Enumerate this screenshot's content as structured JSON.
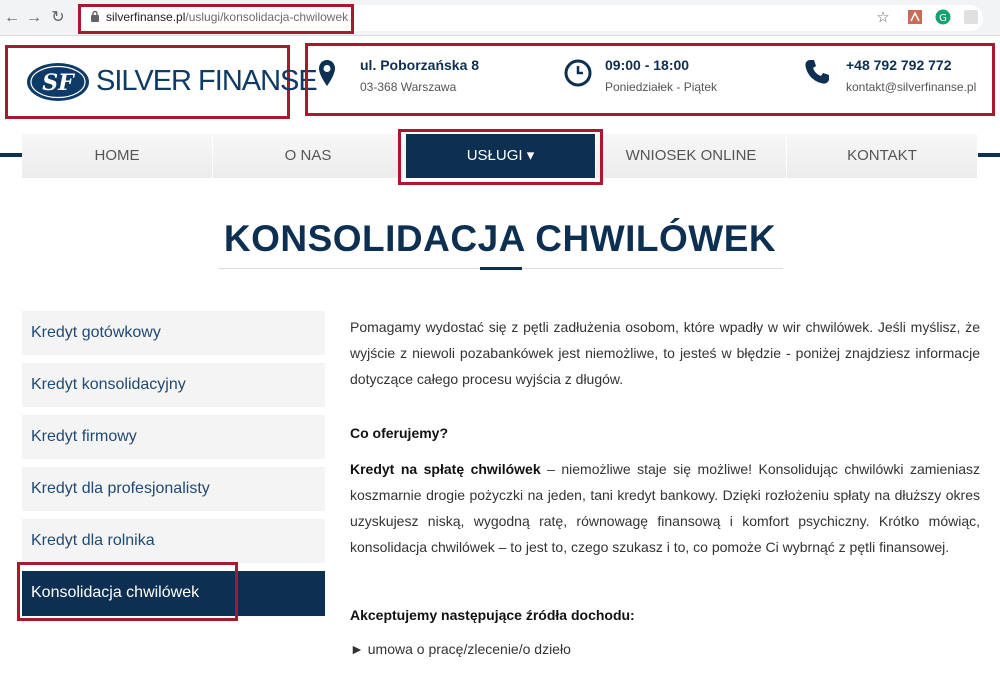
{
  "browser": {
    "url_domain": "silverfinanse.pl",
    "url_path": "/uslugi/konsolidacja-chwilowek",
    "back_icon": "arrow-left-icon",
    "forward_icon": "arrow-right-icon",
    "reload_icon": "reload-icon"
  },
  "logo": {
    "initials": "SF",
    "name": "SILVER FINANSE"
  },
  "contact": {
    "address": {
      "title": "ul. Poborzańska 8",
      "sub": "03-368 Warszawa"
    },
    "hours": {
      "title": "09:00 - 18:00",
      "sub": "Poniedziałek - Piątek"
    },
    "phone": {
      "title": "+48 792 792 772",
      "sub": "kontakt@silverfinanse.pl"
    }
  },
  "nav": {
    "items": [
      {
        "label": "HOME"
      },
      {
        "label": "O NAS"
      },
      {
        "label": "USŁUGI ▾"
      },
      {
        "label": "WNIOSEK ONLINE"
      },
      {
        "label": "KONTAKT"
      }
    ]
  },
  "page": {
    "title": "KONSOLIDACJA CHWILÓWEK"
  },
  "sidebar": {
    "items": [
      {
        "label": "Kredyt gotówkowy"
      },
      {
        "label": "Kredyt konsolidacyjny"
      },
      {
        "label": "Kredyt firmowy"
      },
      {
        "label": "Kredyt dla profesjonalisty"
      },
      {
        "label": "Kredyt dla rolnika"
      },
      {
        "label": "Konsolidacja chwilówek"
      }
    ]
  },
  "content": {
    "intro": "Pomagamy wydostać się z pętli zadłużenia osobom, które wpadły w wir chwilówek. Jeśli myślisz, że wyjście z niewoli pozabankówek jest niemożliwe, to jesteś w błędzie - poniżej znajdziesz informacje dotyczące całego procesu wyjścia z długów.",
    "offer_heading": "Co oferujemy?",
    "offer_lead": "Kredyt na spłatę chwilówek",
    "offer_text": " – niemożliwe staje się możliwe! Konsolidując chwilówki zamieniasz koszmarnie drogie pożyczki na jeden, tani kredyt bankowy. Dzięki rozłożeniu spłaty na dłuższy okres uzyskujesz niską, wygodną ratę, równowagę finansową i komfort psychiczny. Krótko mówiąc, konsolidacja chwilówek – to jest to, czego szukasz i to, co pomoże Ci wybrnąć z pętli finansowej.",
    "income_heading": "Akceptujemy następujące źródła dochodu:",
    "income_items": [
      "► umowa o pracę/zlecenie/o dzieło"
    ]
  }
}
